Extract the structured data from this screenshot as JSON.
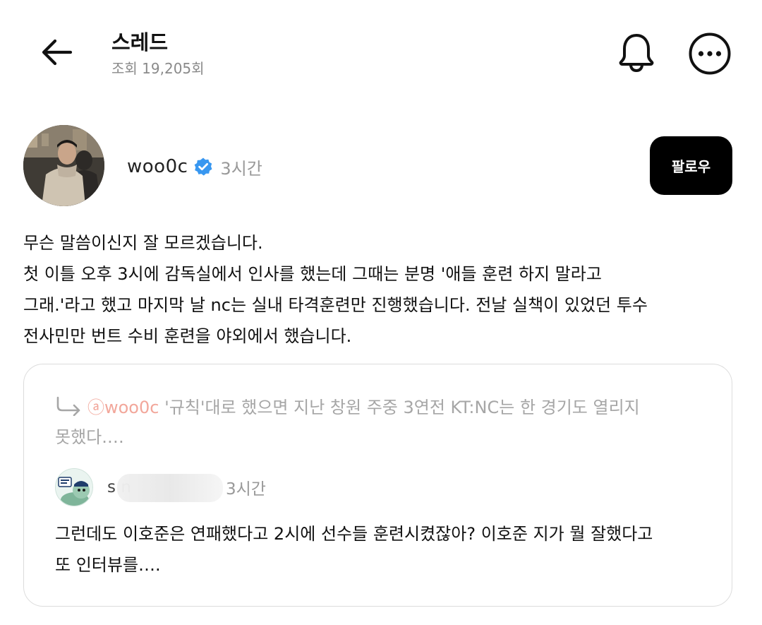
{
  "header": {
    "title": "스레드",
    "views": "조회 19,205회",
    "icons": {
      "back": "arrow-left-icon",
      "notifications": "bell-icon",
      "more": "more-horizontal-icon"
    }
  },
  "post": {
    "author": "woo0c",
    "verified": true,
    "time": "3시간",
    "follow_label": "팔로우",
    "body_lines": [
      "무슨 말씀이신지 잘 모르겠습니다.",
      "첫 이틀 오후 3시에 감독실에서 인사를 했는데 그때는 분명 '애들 훈련 하지 말라고",
      "그래.'라고 했고 마지막 날 nc는 실내 타격훈련만 진행했습니다. 전날 실책이 있었던 투수",
      "전사민만 번트 수비 훈련을 야외에서 했습니다."
    ]
  },
  "quote": {
    "reply_to": {
      "mention": "ⓐwoo0c",
      "line1_rest": " '규칙'대로 했으면 지난 창원 주중 3연전 KT:NC는 한 경기도 열리지",
      "line2": "못했다.…"
    },
    "author": "s          n",
    "time": "3시간",
    "body_lines": [
      "그런데도 이호준은 연패했다고 2시에 선수들 훈련시켰잖아? 이호준 지가 뭘 잘했다고",
      "또 인터뷰를…."
    ]
  },
  "colors": {
    "verified_badge": "#3897f0",
    "muted_text": "#999999",
    "mention_accent": "#f2a79b",
    "follow_button_bg": "#000000"
  }
}
